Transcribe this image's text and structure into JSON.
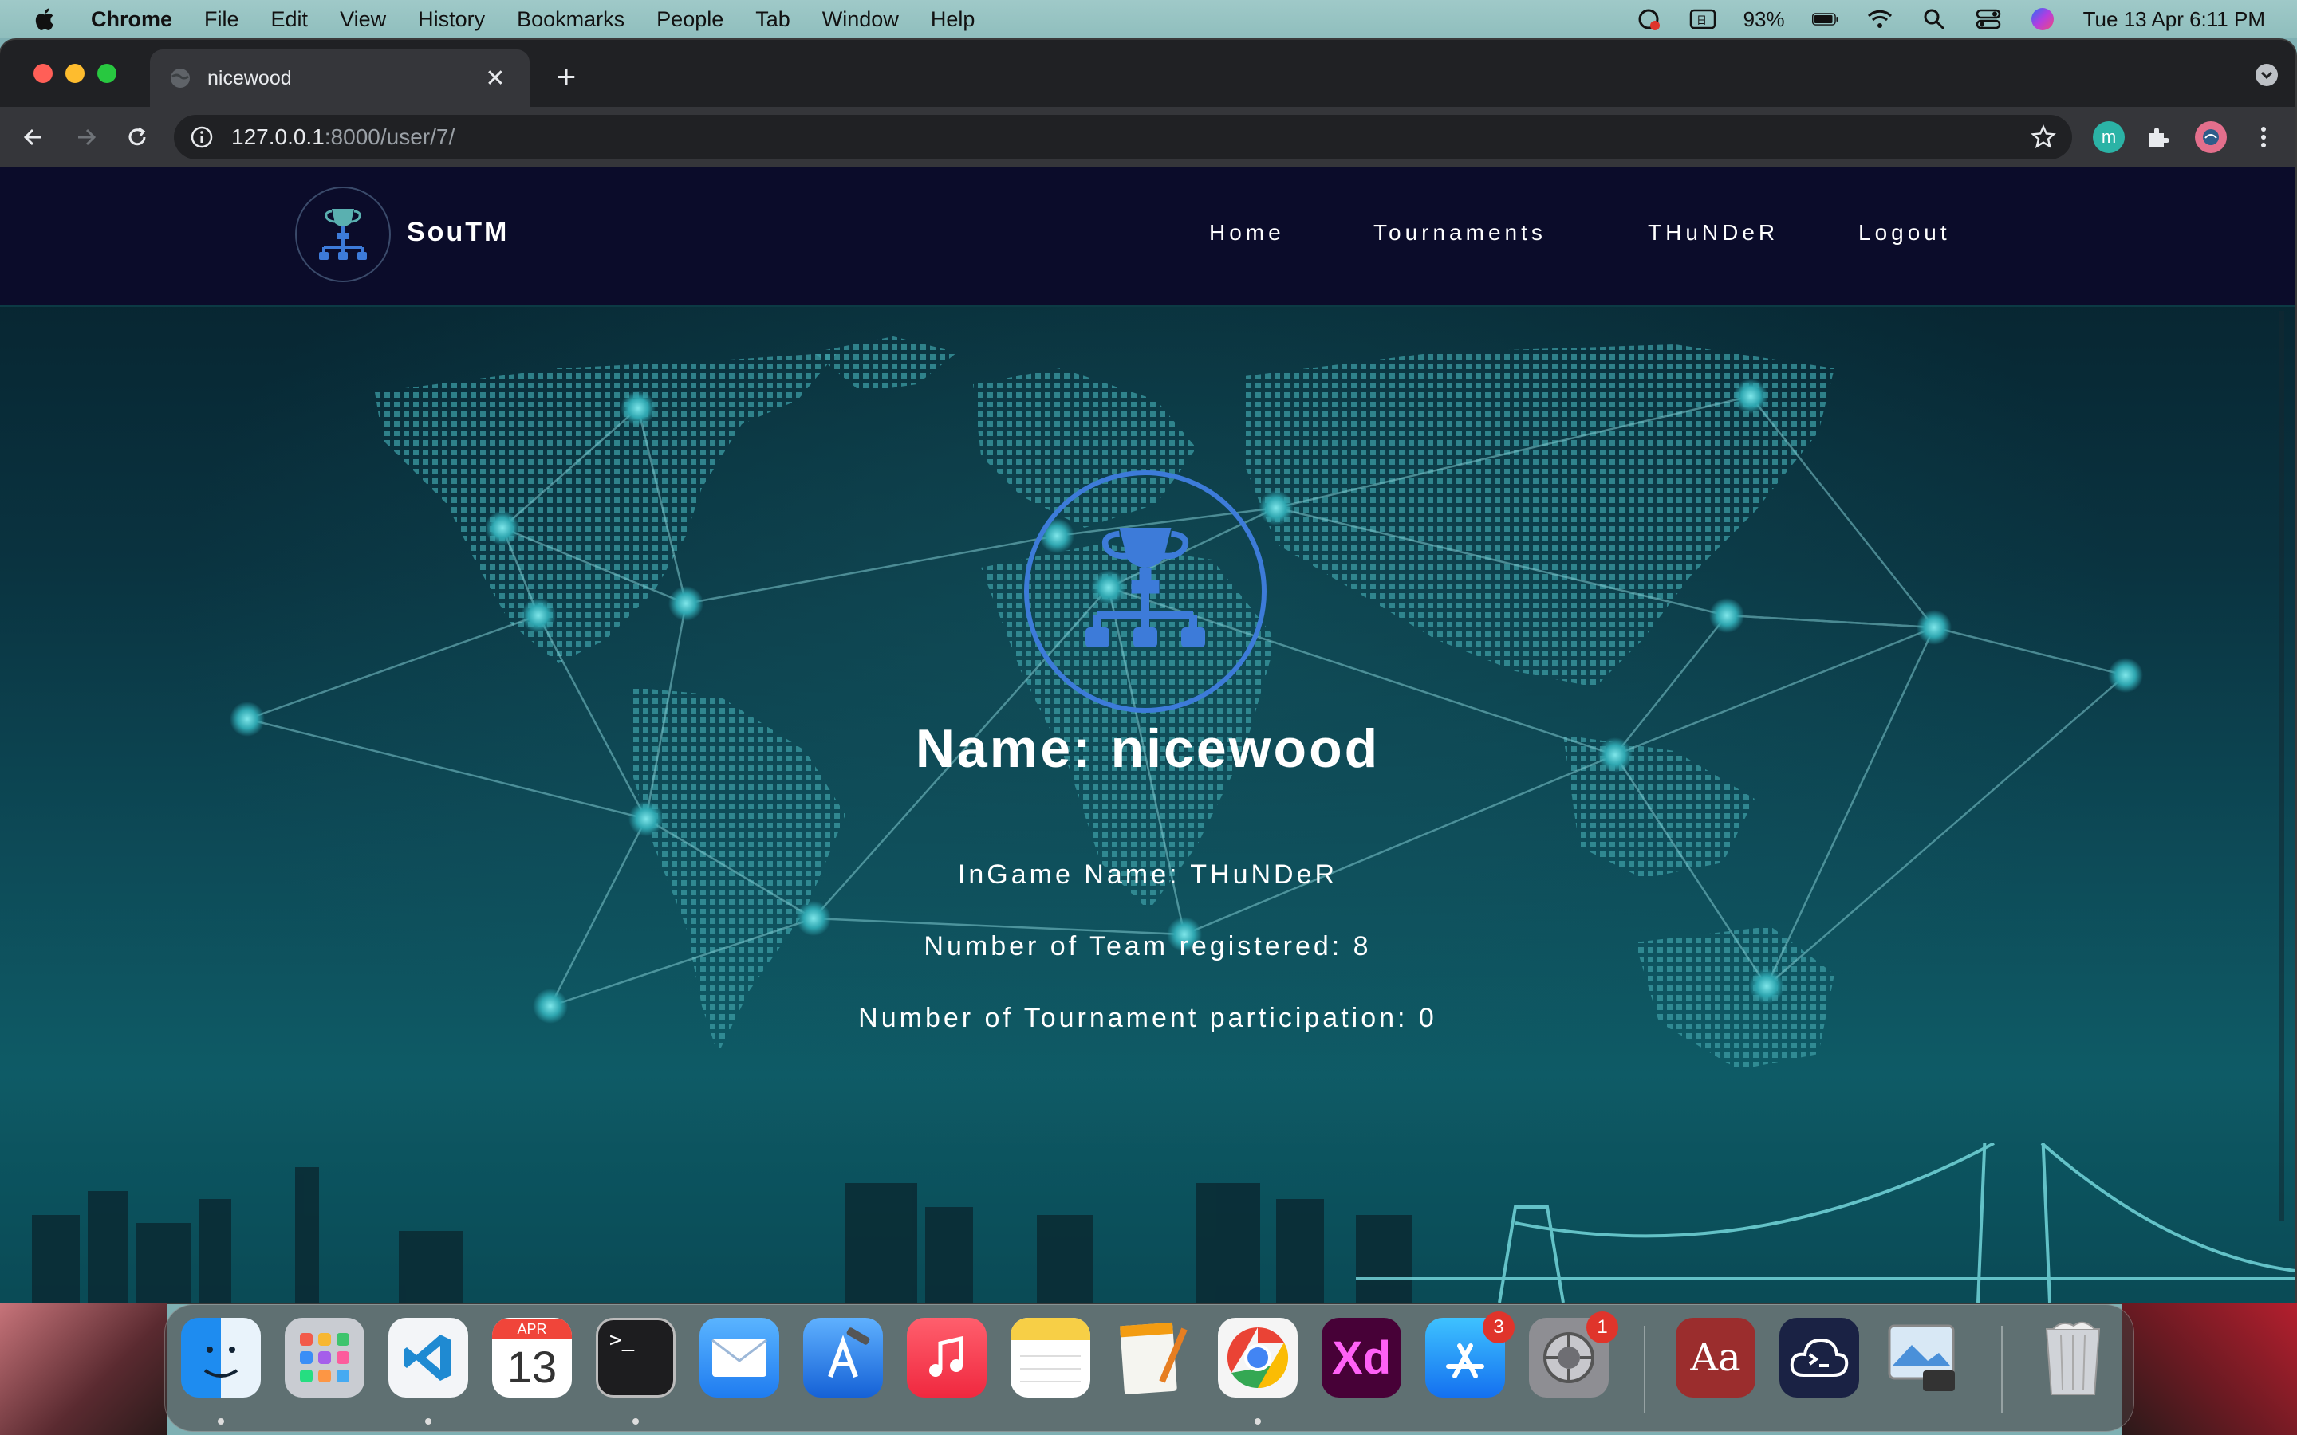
{
  "menubar": {
    "app_name": "Chrome",
    "items": [
      "File",
      "Edit",
      "View",
      "History",
      "Bookmarks",
      "People",
      "Tab",
      "Window",
      "Help"
    ],
    "battery": "93%",
    "datetime": "Tue 13 Apr  6:11 PM"
  },
  "browser": {
    "tab_title": "nicewood",
    "url_host": "127.0.0.1",
    "url_rest": ":8000/user/7/"
  },
  "site": {
    "brand": "SouTM",
    "nav": [
      "Home",
      "Tournaments",
      "THuNDeR",
      "Logout"
    ]
  },
  "profile": {
    "name_line": "Name: nicewood",
    "ingame_line": "InGame Name: THuNDeR",
    "teams_line": "Number of Team registered: 8",
    "tournaments_line": "Number of Tournament participation: 0"
  },
  "dock": {
    "calendar_month": "APR",
    "calendar_day": "13",
    "appstore_badge": "3",
    "settings_badge": "1",
    "xd_label": "Xd",
    "dictionary_label": "Aa"
  },
  "colors": {
    "accent_blue": "#3d7bd9",
    "navbar_bg": "#0b0c2a",
    "hero_teal": "#0d4a57"
  }
}
